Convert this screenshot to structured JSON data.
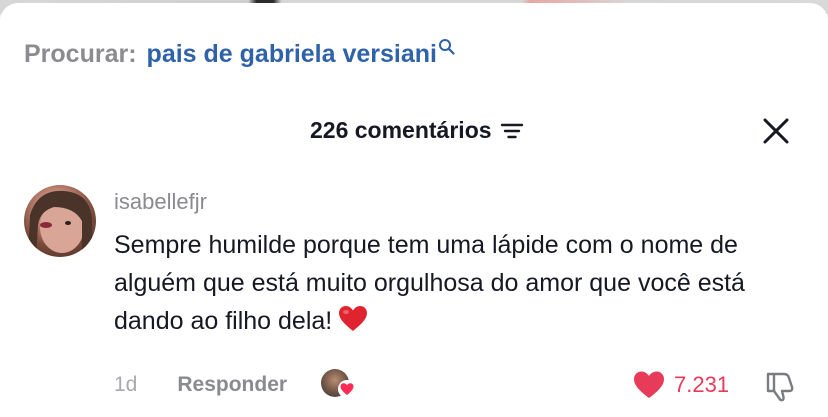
{
  "search": {
    "label": "Procurar:",
    "query": "pais de gabriela versiani",
    "icon": "search-icon"
  },
  "comments_header": {
    "count_label": "226 comentários",
    "filter_icon": "filter-lines-icon",
    "close_icon": "close-icon"
  },
  "comment": {
    "username": "isabellefjr",
    "text": "Sempre humilde porque tem uma lápide com o nome de alguém que está muito orgulhosa do amor que você está dando ao filho dela!",
    "emoji": "red-heart-emoji",
    "time": "1d",
    "reply_label": "Responder",
    "like_count": "7.231",
    "liked_by_creator": true
  },
  "colors": {
    "query_blue": "#2f62a8",
    "like_red": "#e83b5a",
    "text_dark": "#161823",
    "text_gray": "#8a8b91"
  }
}
